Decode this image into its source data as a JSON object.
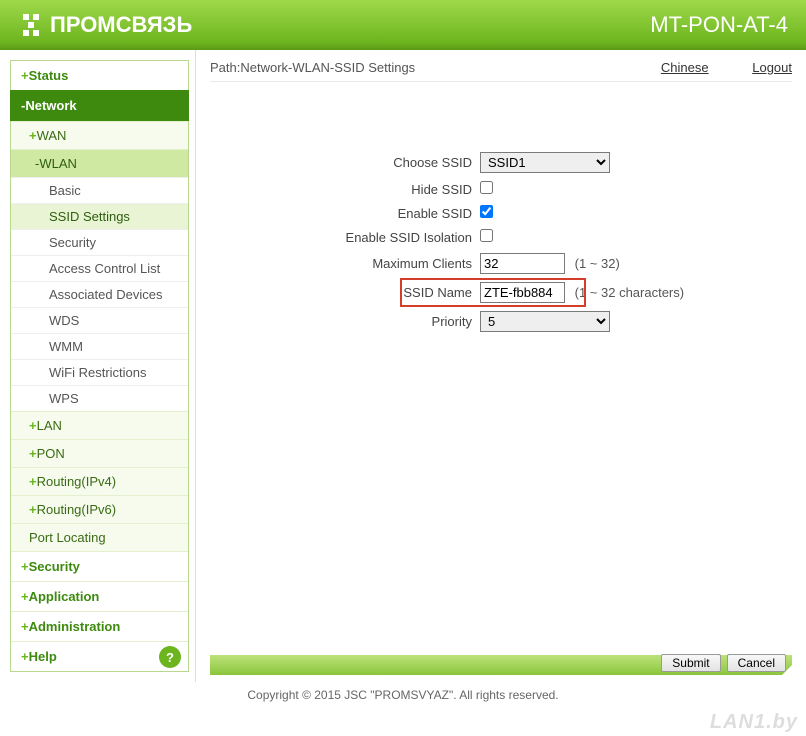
{
  "header": {
    "brand": "ПРОМСВЯЗЬ",
    "model": "MT-PON-AT-4"
  },
  "sidebar": {
    "status": "Status",
    "network": "Network",
    "wan": "WAN",
    "wlan": "WLAN",
    "wlan_items": {
      "basic": "Basic",
      "ssid_settings": "SSID Settings",
      "security": "Security",
      "acl": "Access Control List",
      "assoc": "Associated Devices",
      "wds": "WDS",
      "wmm": "WMM",
      "wifi_restrict": "WiFi Restrictions",
      "wps": "WPS"
    },
    "lan": "LAN",
    "pon": "PON",
    "routing4": "Routing(IPv4)",
    "routing6": "Routing(IPv6)",
    "port_locating": "Port Locating",
    "security_section": "Security",
    "application": "Application",
    "administration": "Administration",
    "help": "Help"
  },
  "pathbar": {
    "label": "Path:Network-WLAN-SSID Settings",
    "chinese": "Chinese",
    "logout": "Logout"
  },
  "form": {
    "choose_ssid_label": "Choose SSID",
    "choose_ssid_value": "SSID1",
    "hide_ssid_label": "Hide SSID",
    "hide_ssid_checked": false,
    "enable_ssid_label": "Enable SSID",
    "enable_ssid_checked": true,
    "isolation_label": "Enable SSID Isolation",
    "isolation_checked": false,
    "max_clients_label": "Maximum Clients",
    "max_clients_value": "32",
    "max_clients_hint": "(1 ~ 32)",
    "ssid_name_label": "SSID Name",
    "ssid_name_value": "ZTE-fbb884",
    "ssid_name_hint": "(1 ~ 32 characters)",
    "priority_label": "Priority",
    "priority_value": "5"
  },
  "footer": {
    "submit": "Submit",
    "cancel": "Cancel",
    "copyright": "Copyright © 2015 JSC \"PROMSVYAZ\". All rights reserved."
  },
  "watermark": "LAN1.by"
}
